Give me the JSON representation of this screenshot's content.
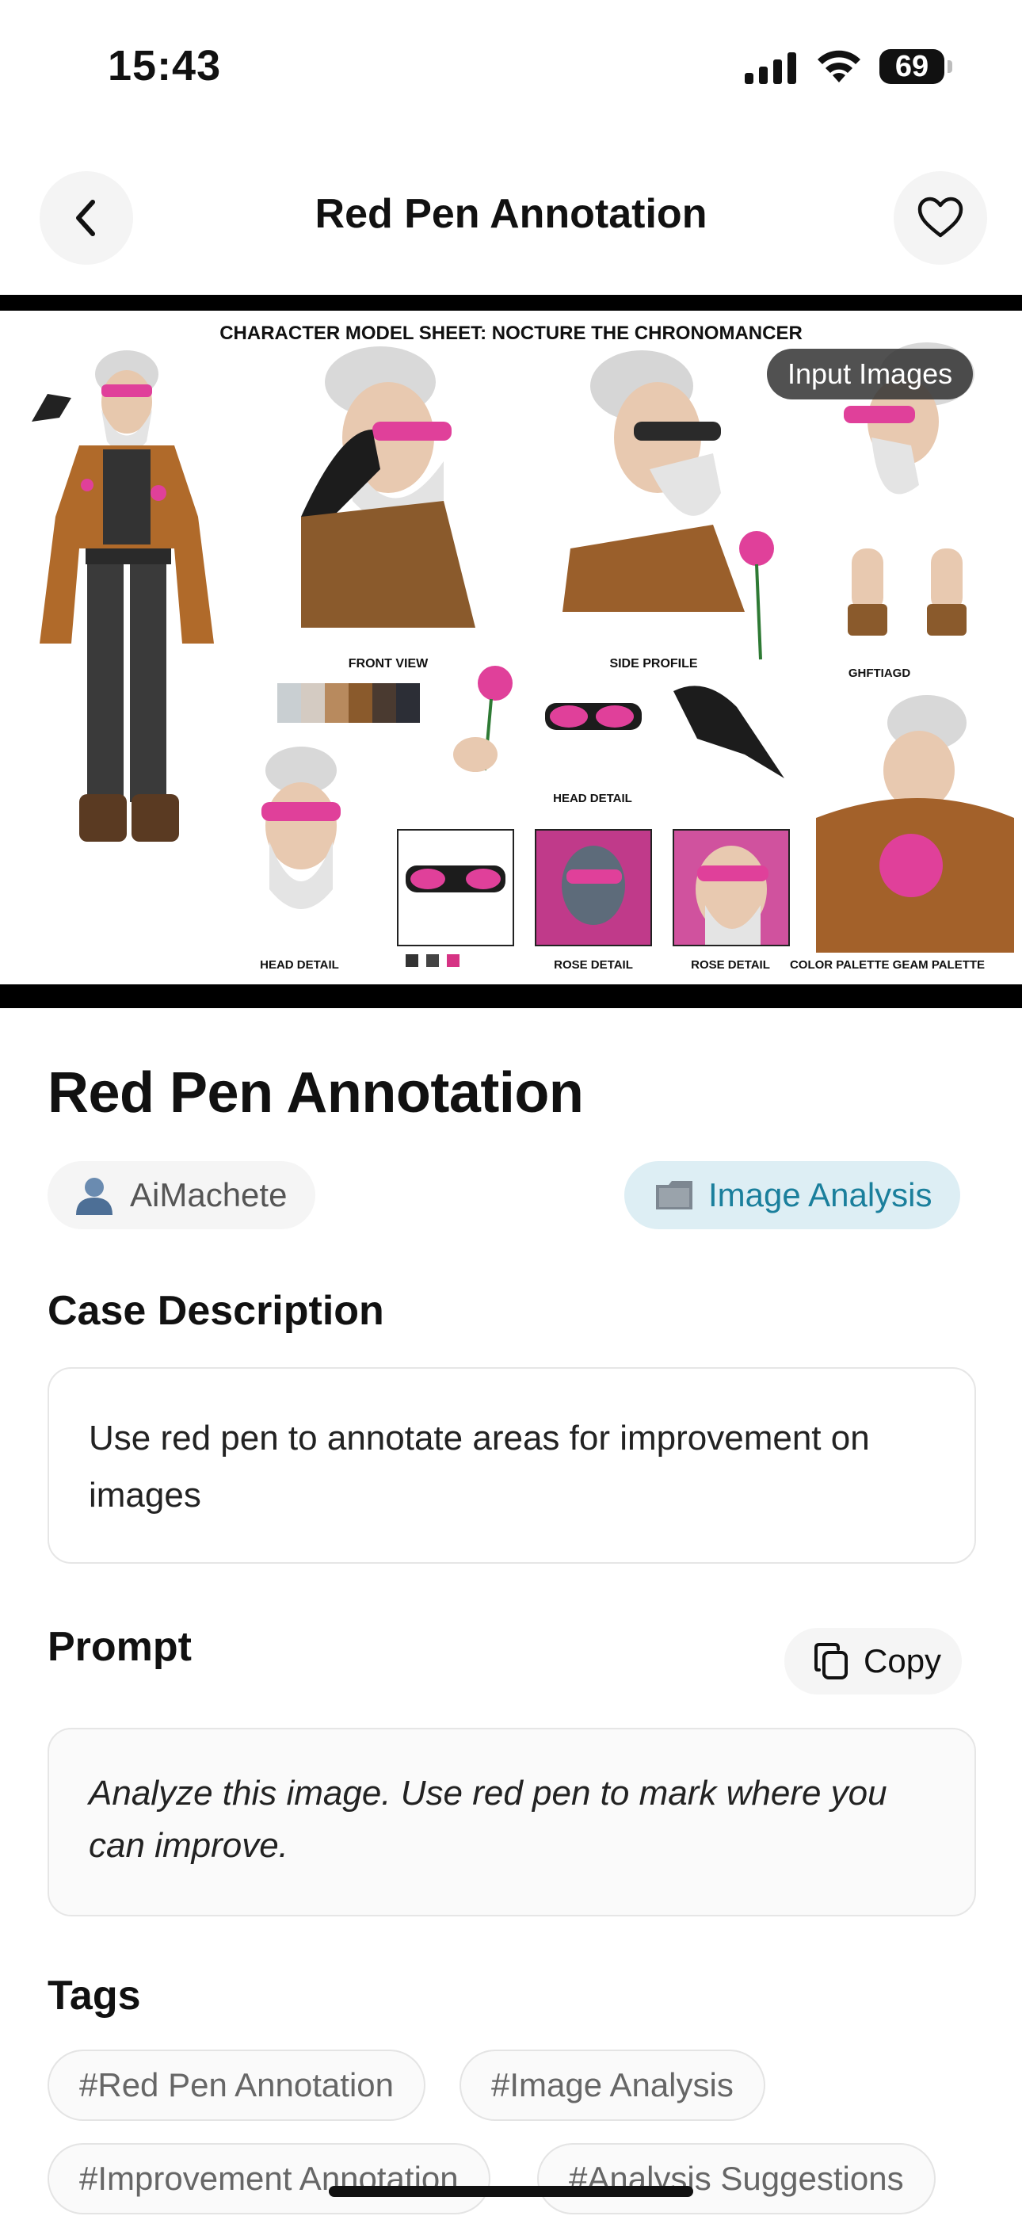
{
  "status_bar": {
    "time": "15:43",
    "battery": "69",
    "battery_level": 0.69
  },
  "nav": {
    "title": "Red Pen Annotation",
    "back_icon": "chevron-left-icon",
    "favorite_icon": "heart-outline-icon"
  },
  "hero": {
    "badge": "Input Images",
    "sheet_title": "CHARACTER MODEL SHEET: NOCTURE THE CHRONOMANCER",
    "labels": {
      "front": "FRONT VIEW",
      "side": "SIDE PROFILE",
      "hands": "GHFTIAGD",
      "head_top": "HEAD DETAIL",
      "head_bottom": "HEAD DETAIL",
      "rose1": "ROSE DETAIL",
      "rose2": "ROSE DETAIL",
      "palette": "COLOR PALETTE GEAM PALETTE"
    },
    "swatches": [
      "#c9cfd2",
      "#d4cbc2",
      "#b88a5e",
      "#8a5a2c",
      "#4a3a30",
      "#2c2e36"
    ],
    "mini_swatches": [
      "#333333",
      "#444444",
      "#d63384"
    ]
  },
  "main": {
    "title": "Red Pen Annotation",
    "author": {
      "name": "AiMachete",
      "icon": "user-icon"
    },
    "category": {
      "name": "Image Analysis",
      "icon": "folder-icon"
    }
  },
  "description": {
    "heading": "Case Description",
    "text": "Use red pen to annotate areas for improvement on images"
  },
  "prompt": {
    "heading": "Prompt",
    "copy_label": "Copy",
    "copy_icon": "copy-icon",
    "text": "Analyze this image. Use red pen to mark where you can improve."
  },
  "tags": {
    "heading": "Tags",
    "items": [
      "#Red Pen Annotation",
      "#Image Analysis",
      "#Improvement Annotation",
      "#Analysis Suggestions"
    ]
  },
  "colors": {
    "accent": "#1a7f9c",
    "accent_bg": "#ddeef4",
    "magenta": "#e0409a",
    "jacket": "#b06a2a"
  }
}
